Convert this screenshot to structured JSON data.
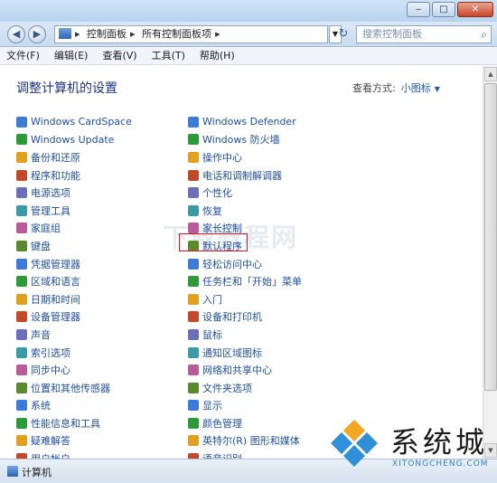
{
  "address": {
    "segments": [
      "控制面板",
      "所有控制面板项"
    ],
    "search_placeholder": "搜索控制面板"
  },
  "menu": [
    "文件(F)",
    "编辑(E)",
    "查看(V)",
    "工具(T)",
    "帮助(H)"
  ],
  "heading": "调整计算机的设置",
  "view_by": {
    "label": "查看方式:",
    "value": "小图标"
  },
  "left_items": [
    "Windows CardSpace",
    "Windows Update",
    "备份和还原",
    "程序和功能",
    "电源选项",
    "管理工具",
    "家庭组",
    "键盘",
    "凭据管理器",
    "区域和语言",
    "日期和时间",
    "设备管理器",
    "声音",
    "索引选项",
    "同步中心",
    "位置和其他传感器",
    "系统",
    "性能信息和工具",
    "疑难解答",
    "用户帐户"
  ],
  "right_items": [
    "Windows Defender",
    "Windows 防火墙",
    "操作中心",
    "电话和调制解调器",
    "个性化",
    "恢复",
    "家长控制",
    "默认程序",
    "轻松访问中心",
    "任务栏和「开始」菜单",
    "入门",
    "设备和打印机",
    "鼠标",
    "通知区域图标",
    "网络和共享中心",
    "文件夹选项",
    "显示",
    "颜色管理",
    "英特尔(R) 图形和媒体",
    "语音识别"
  ],
  "watermark": "下载教程网",
  "status_text": "计算机",
  "logo": {
    "cn": "系统城",
    "en": "XITONGCHENG.COM"
  },
  "colors": {
    "link": "#1e4fa0",
    "heading": "#1e3287",
    "highlight": "#e0121c"
  }
}
